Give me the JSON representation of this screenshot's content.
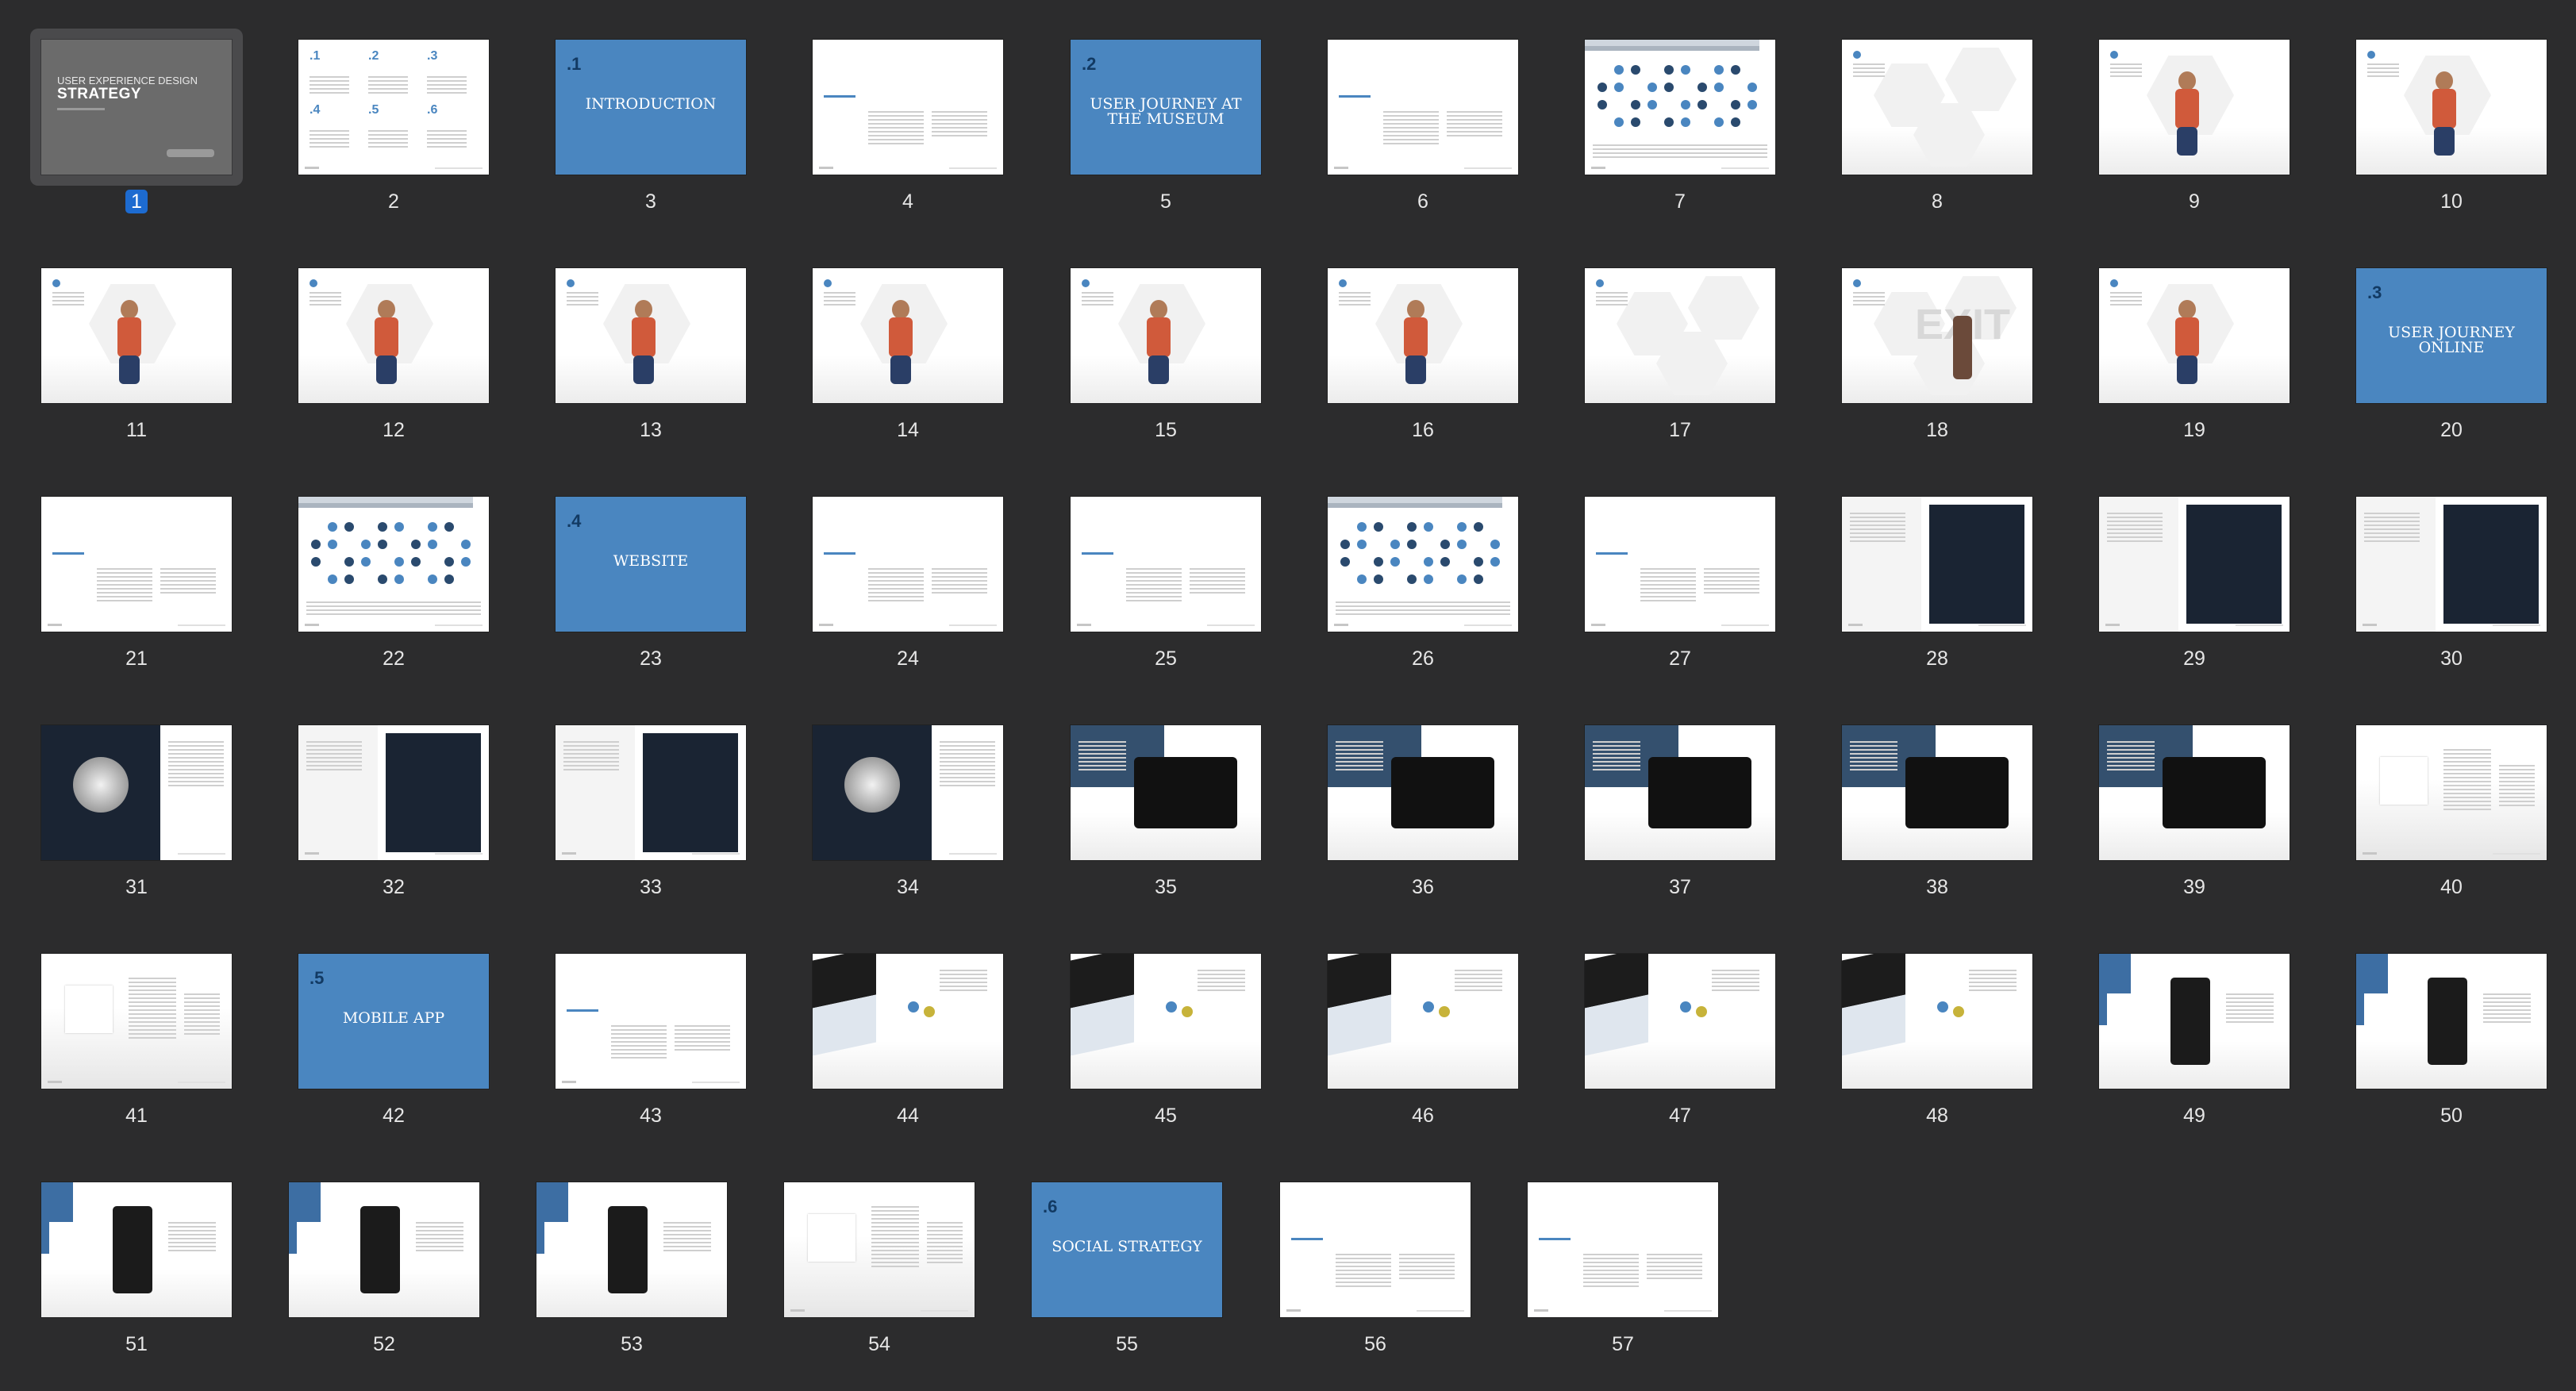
{
  "selected_slide": 1,
  "slides": [
    {
      "n": "1",
      "type": "cover",
      "title1": "USER EXPERIENCE DESIGN",
      "title2": "STRATEGY"
    },
    {
      "n": "2",
      "type": "toc",
      "toc_numbers": [
        ".1",
        ".2",
        ".3",
        ".4",
        ".5",
        ".6"
      ]
    },
    {
      "n": "3",
      "type": "section",
      "num": ".1",
      "title": "INTRODUCTION"
    },
    {
      "n": "4",
      "type": "text"
    },
    {
      "n": "5",
      "type": "section",
      "num": ".2",
      "title": "USER JOURNEY AT THE MUSEUM"
    },
    {
      "n": "6",
      "type": "text"
    },
    {
      "n": "7",
      "type": "flow"
    },
    {
      "n": "8",
      "type": "hex"
    },
    {
      "n": "9",
      "type": "illus"
    },
    {
      "n": "10",
      "type": "illus"
    },
    {
      "n": "11",
      "type": "illus"
    },
    {
      "n": "12",
      "type": "illus"
    },
    {
      "n": "13",
      "type": "illus"
    },
    {
      "n": "14",
      "type": "illus"
    },
    {
      "n": "15",
      "type": "illus"
    },
    {
      "n": "16",
      "type": "illus"
    },
    {
      "n": "17",
      "type": "hex"
    },
    {
      "n": "18",
      "type": "exit",
      "word": "EXIT"
    },
    {
      "n": "19",
      "type": "illus"
    },
    {
      "n": "20",
      "type": "section",
      "num": ".3",
      "title": "USER JOURNEY ONLINE"
    },
    {
      "n": "21",
      "type": "text"
    },
    {
      "n": "22",
      "type": "flow"
    },
    {
      "n": "23",
      "type": "section",
      "num": ".4",
      "title": "WEBSITE"
    },
    {
      "n": "24",
      "type": "text"
    },
    {
      "n": "25",
      "type": "text"
    },
    {
      "n": "26",
      "type": "tree"
    },
    {
      "n": "27",
      "type": "text"
    },
    {
      "n": "28",
      "type": "web"
    },
    {
      "n": "29",
      "type": "web"
    },
    {
      "n": "30",
      "type": "web"
    },
    {
      "n": "31",
      "type": "webdark"
    },
    {
      "n": "32",
      "type": "web"
    },
    {
      "n": "33",
      "type": "web"
    },
    {
      "n": "34",
      "type": "webdark"
    },
    {
      "n": "35",
      "type": "tablet"
    },
    {
      "n": "36",
      "type": "tablet"
    },
    {
      "n": "37",
      "type": "tablet"
    },
    {
      "n": "38",
      "type": "tablet"
    },
    {
      "n": "39",
      "type": "tablet"
    },
    {
      "n": "40",
      "type": "notes"
    },
    {
      "n": "41",
      "type": "notes"
    },
    {
      "n": "42",
      "type": "section",
      "num": ".5",
      "title": "MOBILE APP"
    },
    {
      "n": "43",
      "type": "text"
    },
    {
      "n": "44",
      "type": "mobile"
    },
    {
      "n": "45",
      "type": "mobile"
    },
    {
      "n": "46",
      "type": "mobile"
    },
    {
      "n": "47",
      "type": "mobile"
    },
    {
      "n": "48",
      "type": "mobile"
    },
    {
      "n": "49",
      "type": "phone"
    },
    {
      "n": "50",
      "type": "phone"
    },
    {
      "n": "51",
      "type": "phone"
    },
    {
      "n": "52",
      "type": "phone"
    },
    {
      "n": "53",
      "type": "phone"
    },
    {
      "n": "54",
      "type": "notes"
    },
    {
      "n": "55",
      "type": "section",
      "num": ".6",
      "title": "SOCIAL STRATEGY"
    },
    {
      "n": "56",
      "type": "text"
    },
    {
      "n": "57",
      "type": "text"
    }
  ],
  "colors": {
    "background": "#2c2c2d",
    "section_blue": "#4a86c0",
    "selection": "#1d6bd0"
  }
}
